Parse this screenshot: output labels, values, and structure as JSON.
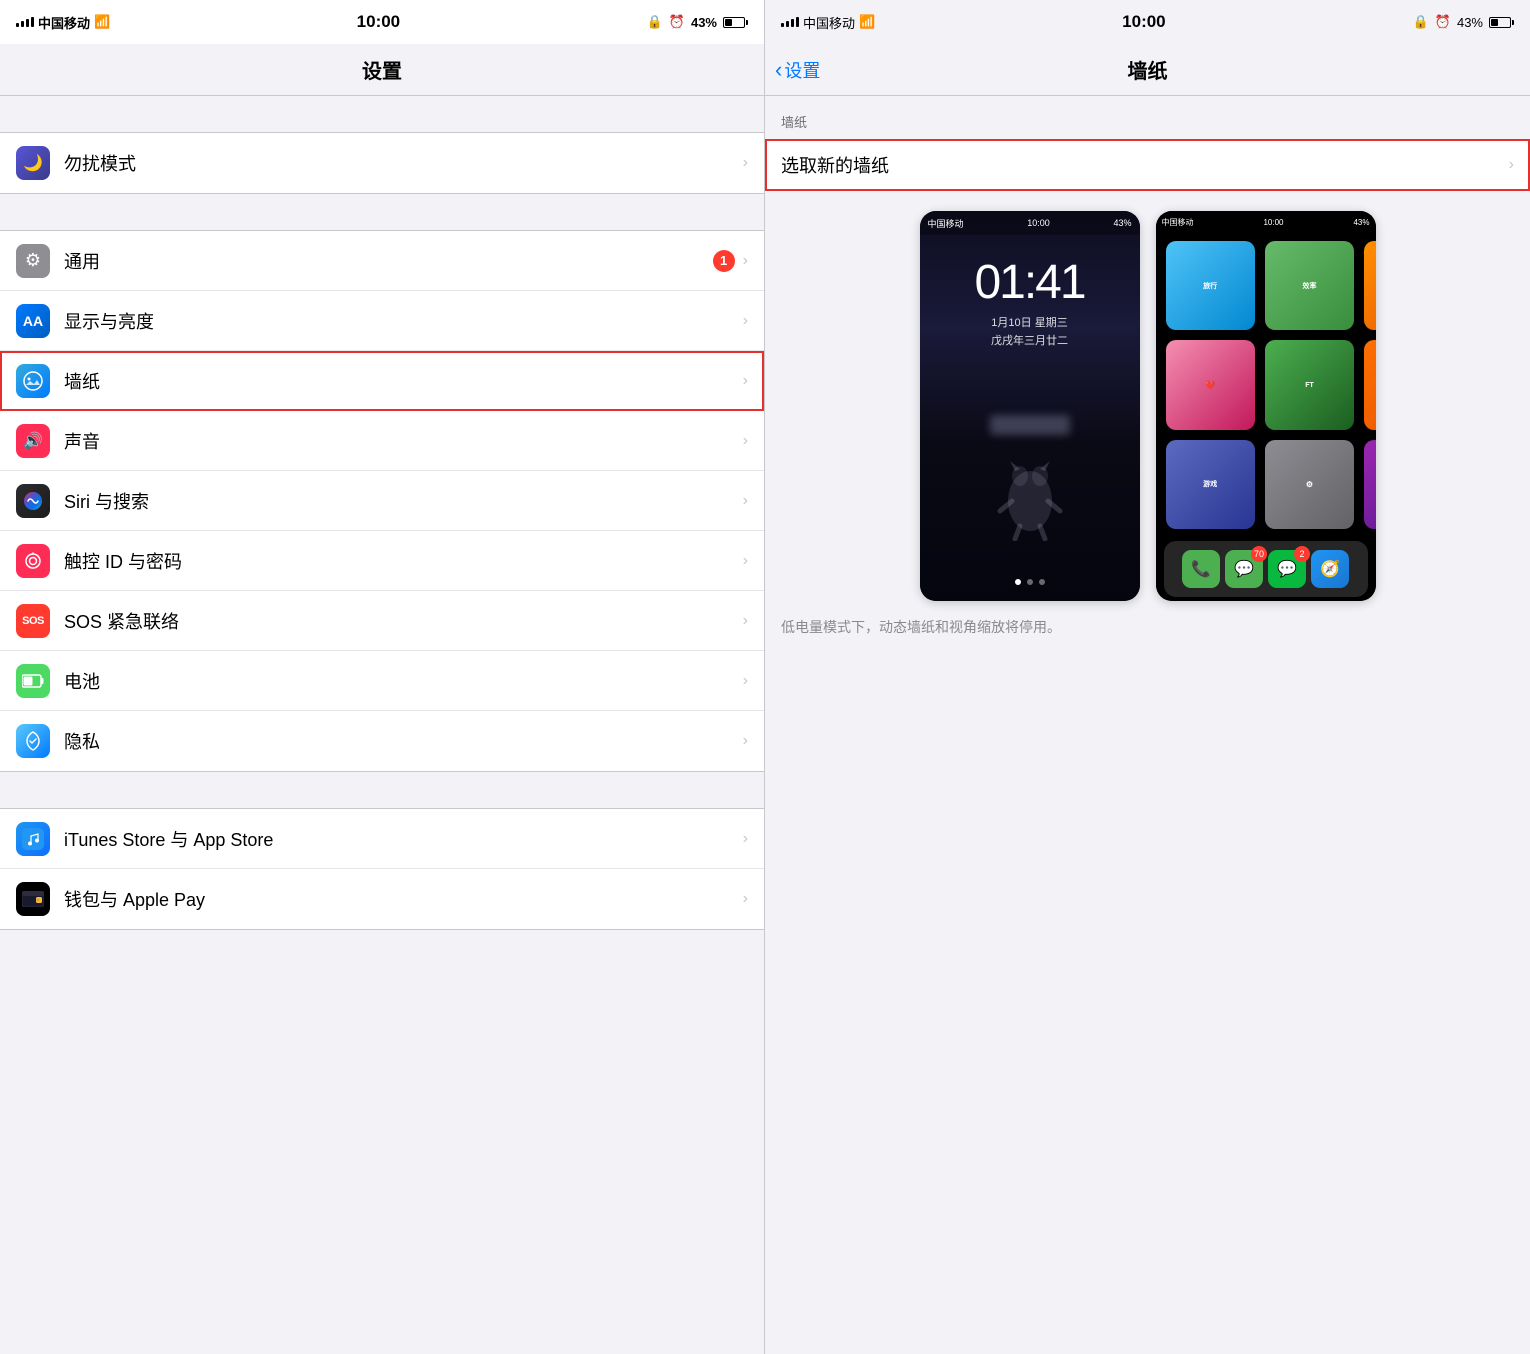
{
  "left": {
    "status": {
      "carrier": "中国移动",
      "wifi": "WiFi",
      "time": "10:00",
      "lock": "🔒",
      "alarm": "⏰",
      "battery": "43%"
    },
    "title": "设置",
    "items_group1": [
      {
        "id": "dnd",
        "icon_class": "icon-dnd",
        "icon": "🌙",
        "label": "勿扰模式",
        "badge": null
      }
    ],
    "items_group2": [
      {
        "id": "general",
        "icon_class": "icon-general",
        "icon": "⚙",
        "label": "通用",
        "badge": "1"
      },
      {
        "id": "display",
        "icon_class": "icon-display",
        "icon": "AA",
        "label": "显示与亮度",
        "badge": null
      },
      {
        "id": "wallpaper",
        "icon_class": "icon-wallpaper",
        "icon": "✿",
        "label": "墙纸",
        "badge": null,
        "highlighted": true
      },
      {
        "id": "sounds",
        "icon_class": "icon-sounds",
        "icon": "🔊",
        "label": "声音",
        "badge": null
      },
      {
        "id": "siri",
        "icon_class": "icon-siri",
        "icon": "◎",
        "label": "Siri 与搜索",
        "badge": null
      },
      {
        "id": "touchid",
        "icon_class": "icon-touchid",
        "icon": "👆",
        "label": "触控 ID 与密码",
        "badge": null
      },
      {
        "id": "sos",
        "icon_class": "icon-sos",
        "icon": "SOS",
        "label": "SOS 紧急联络",
        "badge": null
      },
      {
        "id": "battery",
        "icon_class": "icon-battery",
        "icon": "🔋",
        "label": "电池",
        "badge": null
      },
      {
        "id": "privacy",
        "icon_class": "icon-privacy",
        "icon": "✋",
        "label": "隐私",
        "badge": null
      }
    ],
    "items_group3": [
      {
        "id": "itunes",
        "icon_class": "icon-itunes",
        "icon": "A",
        "label": "iTunes Store 与 App Store",
        "badge": null
      },
      {
        "id": "wallet",
        "icon_class": "icon-wallet",
        "icon": "💳",
        "label": "钱包与 Apple Pay",
        "badge": null
      }
    ]
  },
  "right": {
    "status": {
      "carrier": "中国移动",
      "wifi": "WiFi",
      "time": "10:00",
      "lock": "🔒",
      "alarm": "⏰",
      "battery": "43%"
    },
    "back_label": "设置",
    "title": "墙纸",
    "section_label": "墙纸",
    "new_wallpaper_label": "选取新的墙纸",
    "lock_screen": {
      "time": "01:41",
      "date": "1月10日 星期三",
      "lunar": "戊戌年三月廿二"
    },
    "notice": "低电量模式下，动态墙纸和视角缩放将停用。"
  }
}
